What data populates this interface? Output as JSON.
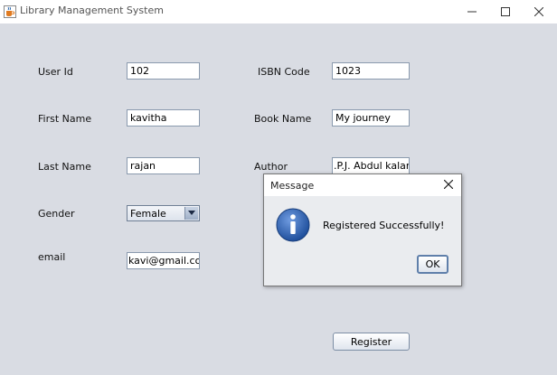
{
  "window": {
    "title": "Library Management System"
  },
  "form": {
    "user_id_label": "User Id",
    "user_id_value": "102",
    "first_name_label": "First Name",
    "first_name_value": "kavitha",
    "last_name_label": "Last Name",
    "last_name_value": "rajan",
    "gender_label": "Gender",
    "gender_value": "Female",
    "email_label": "email",
    "email_value": "kavi@gmail.com",
    "isbn_label": "ISBN Code",
    "isbn_value": "1023",
    "book_name_label": "Book Name",
    "book_name_value": "My journey",
    "author_label": "Author",
    "author_value": ".P.J. Abdul kalam",
    "register_label": "Register"
  },
  "dialog": {
    "title": "Message",
    "message": "Registered Successfully!",
    "ok_label": "OK"
  },
  "icons": {
    "app": "java-cup-icon",
    "info": "info-icon",
    "minimize": "minimize-icon",
    "maximize": "maximize-icon",
    "close": "close-icon"
  },
  "colors": {
    "background": "#d9dce3",
    "info_blue": "#2f5fa8"
  }
}
